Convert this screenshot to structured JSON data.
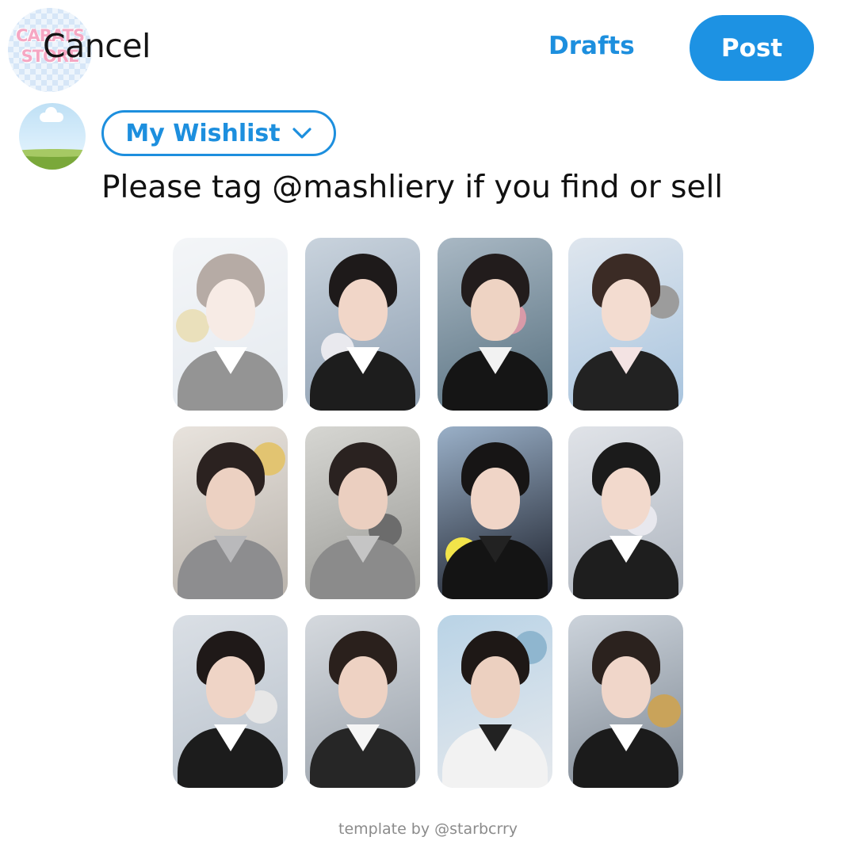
{
  "watermark": {
    "line1": "CARATS",
    "line2": "STORE"
  },
  "header": {
    "cancel_label": "Cancel",
    "drafts_label": "Drafts",
    "post_label": "Post"
  },
  "composer": {
    "audience_label": "My Wishlist",
    "text": "Please tag @mashliery if you find or sell"
  },
  "colors": {
    "accent": "#1d92e3",
    "text": "#111111",
    "muted": "#8b8b8b"
  },
  "photocards": [
    {
      "name": "photocard-1",
      "faded": true
    },
    {
      "name": "photocard-2",
      "faded": false
    },
    {
      "name": "photocard-3",
      "faded": false
    },
    {
      "name": "photocard-4",
      "faded": false
    },
    {
      "name": "photocard-5",
      "faded": false
    },
    {
      "name": "photocard-6",
      "faded": false
    },
    {
      "name": "photocard-7",
      "faded": false
    },
    {
      "name": "photocard-8",
      "faded": false
    },
    {
      "name": "photocard-9",
      "faded": false
    },
    {
      "name": "photocard-10",
      "faded": false
    },
    {
      "name": "photocard-11",
      "faded": false
    },
    {
      "name": "photocard-12",
      "faded": false
    }
  ],
  "footer": {
    "credit": "template by @starbcrry"
  }
}
